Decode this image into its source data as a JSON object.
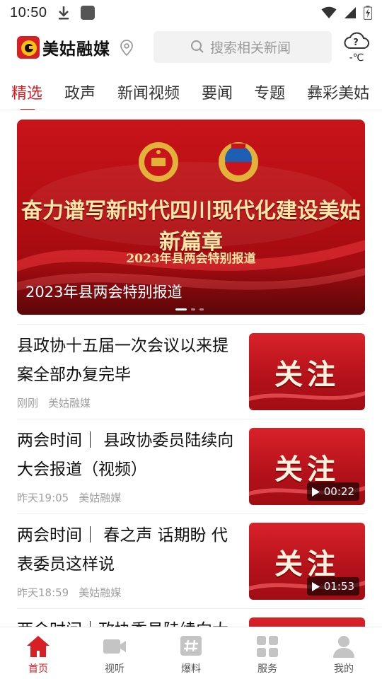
{
  "status_bar": {
    "time": "10:50",
    "icons": [
      "download-icon",
      "notification-square-icon",
      "wifi-icon",
      "signal-icon",
      "battery-charging-icon"
    ]
  },
  "header": {
    "logo_text": "美姑融媒",
    "search_placeholder": "搜索相关新闻",
    "weather_temp": "-℃",
    "weather_icon": "cloud-question-icon"
  },
  "tabs": [
    {
      "label": "精选",
      "active": true
    },
    {
      "label": "政声"
    },
    {
      "label": "新闻视频"
    },
    {
      "label": "要闻"
    },
    {
      "label": "专题"
    },
    {
      "label": "彝彩美姑"
    }
  ],
  "banner": {
    "headline": "奋力谱写新时代四川现代化建设美姑新篇章",
    "subtitle": "2023年县两会特别报道",
    "caption": "2023年县两会特别报道",
    "slide_count": 3,
    "active_slide": 1
  },
  "news": [
    {
      "title": "县政协十五届一次会议以来提案全部办复完毕",
      "time": "刚刚",
      "source": "美姑融媒",
      "thumb_text": "关注",
      "duration": ""
    },
    {
      "title": "两会时间｜ 县政协委员陆续向大会报道（视频）",
      "time": "昨天19:05",
      "source": "美姑融媒",
      "thumb_text": "关注",
      "duration": "00:22"
    },
    {
      "title": "两会时间｜ 春之声 话期盼 代表委员这样说",
      "time": "昨天18:59",
      "source": "美姑融媒",
      "thumb_text": "关注",
      "duration": "01:53"
    },
    {
      "title": "两会时间｜政协委员陆续向大",
      "time": "",
      "source": "",
      "thumb_text": "",
      "duration": ""
    }
  ],
  "bottom_nav": [
    {
      "label": "首页",
      "icon": "home-icon",
      "active": true
    },
    {
      "label": "视听",
      "icon": "video-camera-icon"
    },
    {
      "label": "爆料",
      "icon": "hashtag-icon"
    },
    {
      "label": "服务",
      "icon": "grid-icon"
    },
    {
      "label": "我的",
      "icon": "user-icon"
    }
  ],
  "colors": {
    "brand_red": "#d71f26",
    "banner_red": "#c8141a",
    "text_dark": "#111111",
    "meta_grey": "#a0a0a0"
  }
}
